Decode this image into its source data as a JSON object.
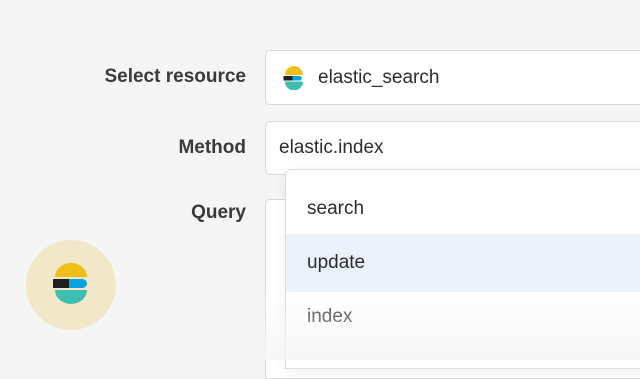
{
  "form": {
    "resource": {
      "label": "Select resource",
      "value": "elastic_search",
      "icon": "elastic-logo-icon"
    },
    "method": {
      "label": "Method",
      "value": "elastic.index"
    },
    "query": {
      "label": "Query",
      "value": ""
    }
  },
  "dropdown": {
    "options": [
      {
        "label": "search",
        "highlighted": false
      },
      {
        "label": "update",
        "highlighted": true
      },
      {
        "label": "index",
        "highlighted": false
      }
    ]
  },
  "badge": {
    "icon": "elastic-logo-icon"
  },
  "colors": {
    "background": "#f5f5f5",
    "highlight": "#ebf2fb",
    "logo_yellow": "#f0bf1a",
    "logo_teal": "#3ebeb0",
    "logo_blue": "#07a5de",
    "logo_black": "#231f20",
    "badge_bg": "#f2e8c9"
  }
}
